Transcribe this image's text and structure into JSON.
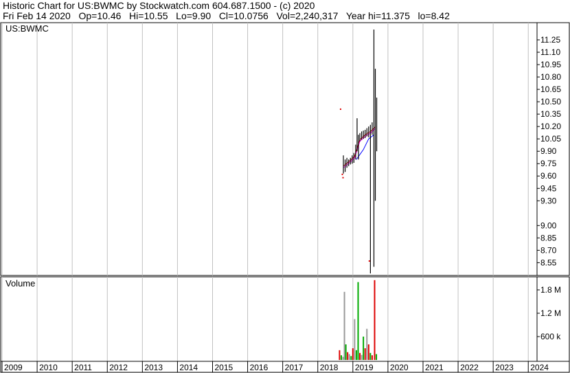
{
  "header": {
    "line1": "Historic Chart for US:BWMC by Stockwatch.com 604.687.1500 - (c) 2020",
    "line2": "Fri Feb 14 2020   Op=10.46   Hi=10.55   Lo=9.90   Cl=10.0756   Vol=2,240,317   Year hi=11.375   lo=8.42"
  },
  "colors": {
    "background": "#ffffff",
    "grid": "#c0c0c0",
    "price": "#000000",
    "ma_pink": "#ff00ff",
    "ma_blue": "#0000ff",
    "ma_red": "#cc0000",
    "volume_up": "#00aa00",
    "volume_down": "#dd0000",
    "volume_neutral": "#999999"
  },
  "chart_data": [
    {
      "type": "line",
      "title": "US:BWMC",
      "ylim": [
        8.42,
        11.4
      ],
      "ticks": [
        "11.25",
        "11.10",
        "10.95",
        "10.80",
        "10.65",
        "10.50",
        "10.35",
        "10.20",
        "10.05",
        "9.90",
        "9.75",
        "9.60",
        "9.45",
        "9.30",
        "9.00",
        "8.85",
        "8.70",
        "8.55"
      ],
      "tick_values": [
        11.25,
        11.1,
        10.95,
        10.8,
        10.65,
        10.5,
        10.35,
        10.2,
        10.05,
        9.9,
        9.75,
        9.6,
        9.45,
        9.3,
        9.0,
        8.85,
        8.7,
        8.55
      ],
      "x_labels": [
        "2009",
        "2010",
        "2011",
        "2012",
        "2013",
        "2014",
        "2015",
        "2016",
        "2017",
        "2018",
        "2019",
        "2020",
        "2021",
        "2022",
        "2023",
        "2024"
      ],
      "xlim": [
        2009.0,
        2024.25
      ],
      "price_bars": [
        {
          "x": 2018.73,
          "lo": 9.63,
          "hi": 9.85
        },
        {
          "x": 2018.78,
          "lo": 9.65,
          "hi": 9.8
        },
        {
          "x": 2018.83,
          "lo": 9.7,
          "hi": 9.82
        },
        {
          "x": 2018.88,
          "lo": 9.72,
          "hi": 9.8
        },
        {
          "x": 2018.93,
          "lo": 9.74,
          "hi": 9.82
        },
        {
          "x": 2018.98,
          "lo": 9.75,
          "hi": 9.85
        },
        {
          "x": 2019.03,
          "lo": 9.76,
          "hi": 9.88
        },
        {
          "x": 2019.08,
          "lo": 9.8,
          "hi": 9.98
        },
        {
          "x": 2019.12,
          "lo": 9.9,
          "hi": 10.3
        },
        {
          "x": 2019.16,
          "lo": 9.8,
          "hi": 10.1
        },
        {
          "x": 2019.2,
          "lo": 10.02,
          "hi": 10.12
        },
        {
          "x": 2019.25,
          "lo": 10.04,
          "hi": 10.14
        },
        {
          "x": 2019.3,
          "lo": 10.05,
          "hi": 10.15
        },
        {
          "x": 2019.35,
          "lo": 10.06,
          "hi": 10.16
        },
        {
          "x": 2019.4,
          "lo": 10.08,
          "hi": 10.18
        },
        {
          "x": 2019.45,
          "lo": 10.07,
          "hi": 10.2
        },
        {
          "x": 2019.5,
          "lo": 8.42,
          "hi": 10.22
        },
        {
          "x": 2019.55,
          "lo": 10.1,
          "hi": 10.25
        },
        {
          "x": 2019.6,
          "lo": 8.5,
          "hi": 11.375
        },
        {
          "x": 2019.64,
          "lo": 9.3,
          "hi": 10.9
        },
        {
          "x": 2019.68,
          "lo": 9.9,
          "hi": 10.55
        }
      ],
      "markers": [
        {
          "x": 2018.65,
          "y": 10.41
        },
        {
          "x": 2018.7,
          "y": 9.62
        },
        {
          "x": 2018.72,
          "y": 9.58
        },
        {
          "x": 2019.47,
          "y": 8.57
        }
      ],
      "ma_pink": [
        [
          2018.73,
          9.7
        ],
        [
          2018.9,
          9.76
        ],
        [
          2019.05,
          9.82
        ],
        [
          2019.2,
          10.02
        ],
        [
          2019.35,
          10.08
        ],
        [
          2019.5,
          10.12
        ],
        [
          2019.65,
          10.18
        ]
      ],
      "ma_blue": [
        [
          2019.1,
          9.8
        ],
        [
          2019.3,
          9.92
        ],
        [
          2019.45,
          10.05
        ],
        [
          2019.6,
          10.1
        ]
      ],
      "ma_red": [
        [
          2018.73,
          9.72
        ],
        [
          2018.9,
          9.78
        ],
        [
          2019.05,
          9.84
        ],
        [
          2019.2,
          10.04
        ],
        [
          2019.35,
          10.1
        ],
        [
          2019.5,
          10.14
        ],
        [
          2019.65,
          10.2
        ]
      ]
    },
    {
      "type": "bar",
      "title": "Volume",
      "ylim": [
        0,
        2100000
      ],
      "ticks": [
        "1.8 M",
        "1.2 M",
        "600 k"
      ],
      "tick_values": [
        1800000,
        1200000,
        600000
      ],
      "bars": [
        {
          "x": 2018.62,
          "v": 250000,
          "c": "down"
        },
        {
          "x": 2018.67,
          "v": 120000,
          "c": "up"
        },
        {
          "x": 2018.72,
          "v": 80000,
          "c": "neutral"
        },
        {
          "x": 2018.76,
          "v": 1750000,
          "c": "neutral"
        },
        {
          "x": 2018.8,
          "v": 400000,
          "c": "up"
        },
        {
          "x": 2018.85,
          "v": 200000,
          "c": "down"
        },
        {
          "x": 2018.9,
          "v": 150000,
          "c": "neutral"
        },
        {
          "x": 2018.95,
          "v": 100000,
          "c": "up"
        },
        {
          "x": 2019.0,
          "v": 300000,
          "c": "down"
        },
        {
          "x": 2019.05,
          "v": 1050000,
          "c": "neutral"
        },
        {
          "x": 2019.1,
          "v": 250000,
          "c": "up"
        },
        {
          "x": 2019.15,
          "v": 2000000,
          "c": "up"
        },
        {
          "x": 2019.2,
          "v": 180000,
          "c": "down"
        },
        {
          "x": 2019.25,
          "v": 130000,
          "c": "neutral"
        },
        {
          "x": 2019.3,
          "v": 600000,
          "c": "up"
        },
        {
          "x": 2019.35,
          "v": 300000,
          "c": "down"
        },
        {
          "x": 2019.4,
          "v": 800000,
          "c": "neutral"
        },
        {
          "x": 2019.45,
          "v": 400000,
          "c": "down"
        },
        {
          "x": 2019.5,
          "v": 180000,
          "c": "up"
        },
        {
          "x": 2019.55,
          "v": 120000,
          "c": "down"
        },
        {
          "x": 2019.62,
          "v": 2050000,
          "c": "down"
        },
        {
          "x": 2019.67,
          "v": 150000,
          "c": "up"
        }
      ]
    }
  ]
}
